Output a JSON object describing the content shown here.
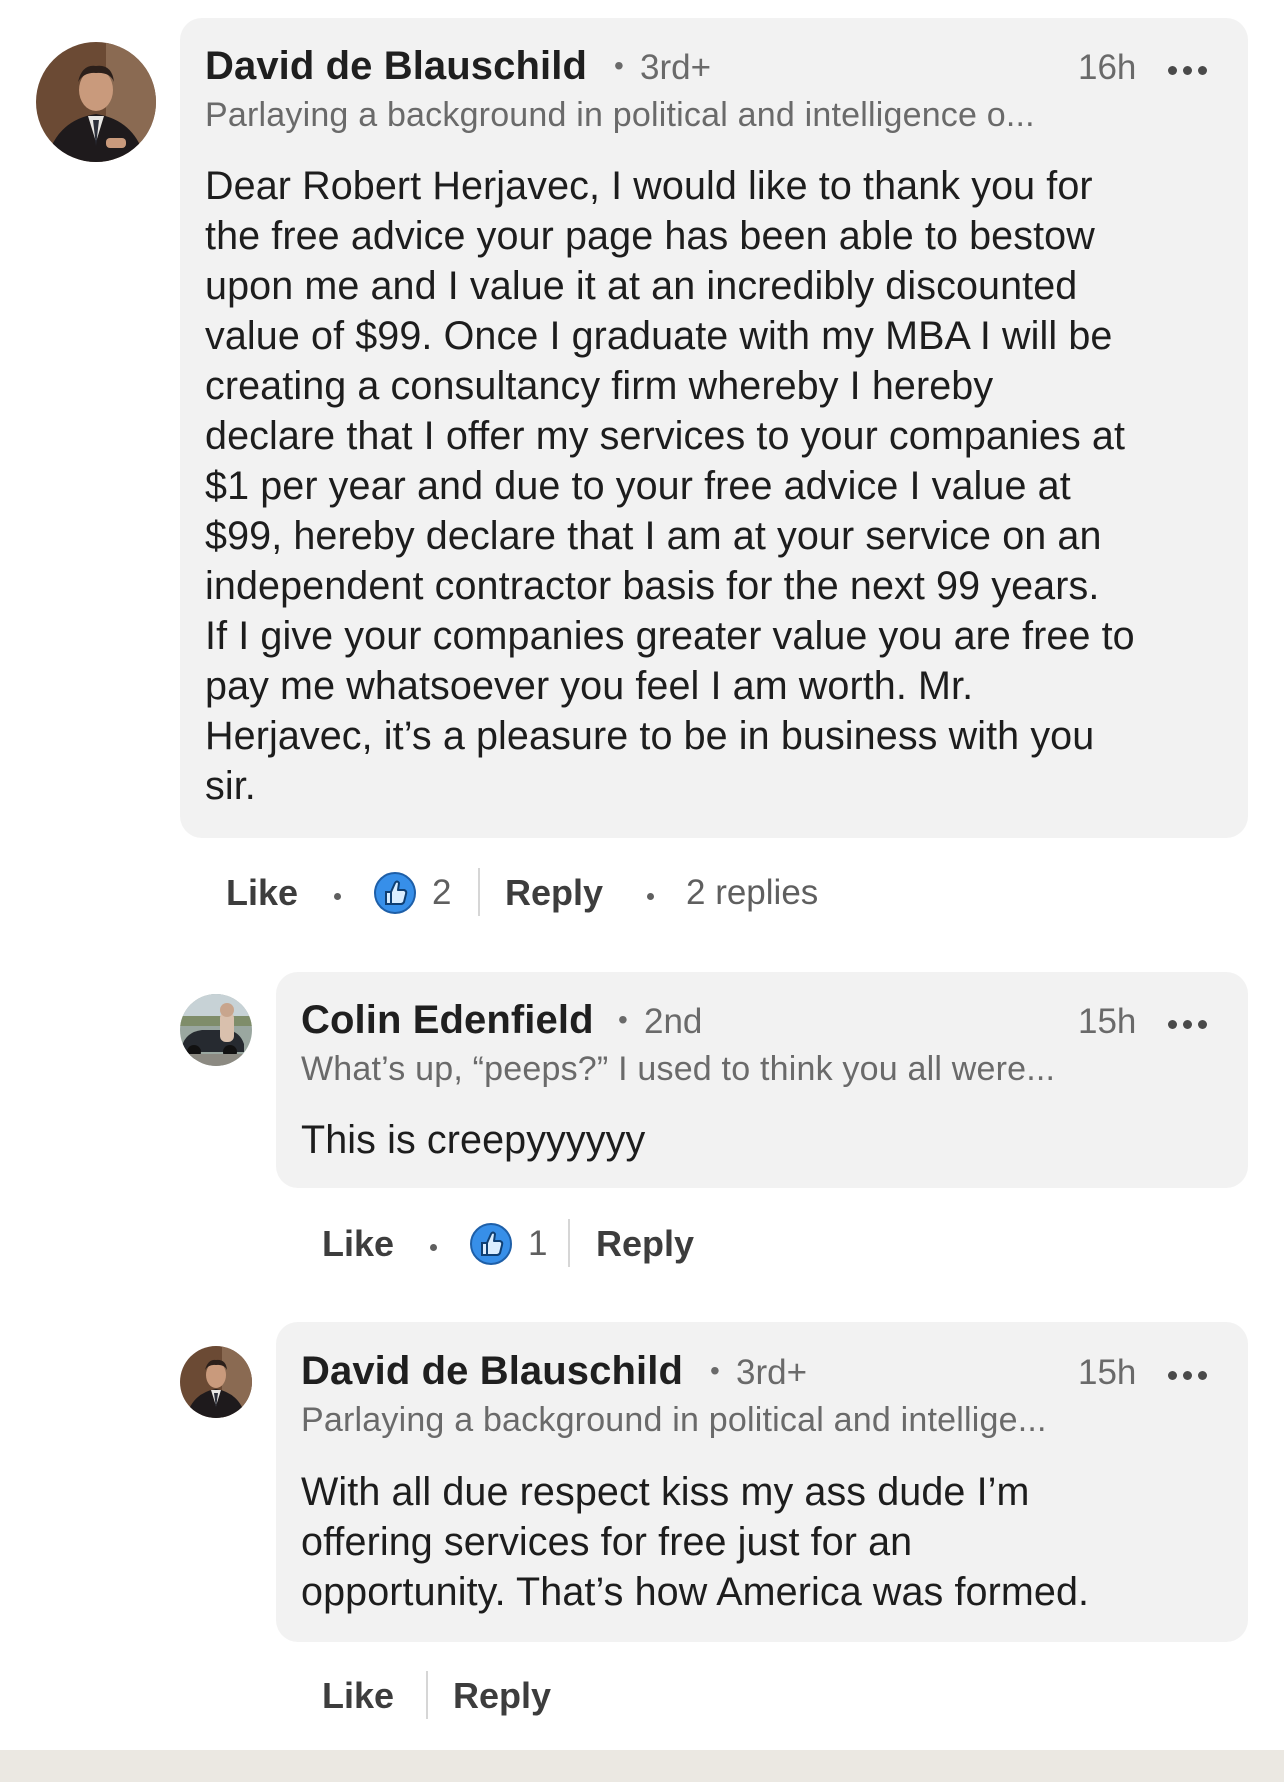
{
  "comments": [
    {
      "author": "David de Blauschild",
      "degree": "3rd+",
      "time": "16h",
      "headline": "Parlaying a background in political and intelligence o...",
      "text": "Dear Robert Herjavec, I would like to thank you for\nthe free advice your page has been able to bestow\nupon me and I value it at an incredibly discounted\nvalue of $99. Once I graduate with my MBA I will be\ncreating a consultancy firm whereby I hereby\ndeclare that I offer my services to your companies at\n$1 per year and due to your free advice I value at\n$99, hereby declare that I am at your service on an\nindependent contractor basis for the next 99 years.\nIf I give your companies greater value you are free to\npay me whatsoever you feel I am worth. Mr.\nHerjavec, it’s a pleasure to be in business with you\nsir.",
      "like_label": "Like",
      "reaction_count": "2",
      "reply_label": "Reply",
      "replies_label": "2 replies"
    },
    {
      "author": "Colin Edenfield",
      "degree": "2nd",
      "time": "15h",
      "headline": "What’s up, “peeps?” I used to think you all were...",
      "text": "This is creepyyyyyy",
      "like_label": "Like",
      "reaction_count": "1",
      "reply_label": "Reply"
    },
    {
      "author": "David de Blauschild",
      "degree": "3rd+",
      "time": "15h",
      "headline": "Parlaying a background in political and intellige...",
      "text": "With all due respect kiss my ass dude I’m\noffering services for free just for an\nopportunity. That’s how America was formed.",
      "like_label": "Like",
      "reply_label": "Reply"
    }
  ],
  "icons": {
    "more": "more-options-icon",
    "like": "like-reaction-icon"
  },
  "colors": {
    "bubble": "#f2f2f2",
    "like_blue": "#378fe9"
  }
}
